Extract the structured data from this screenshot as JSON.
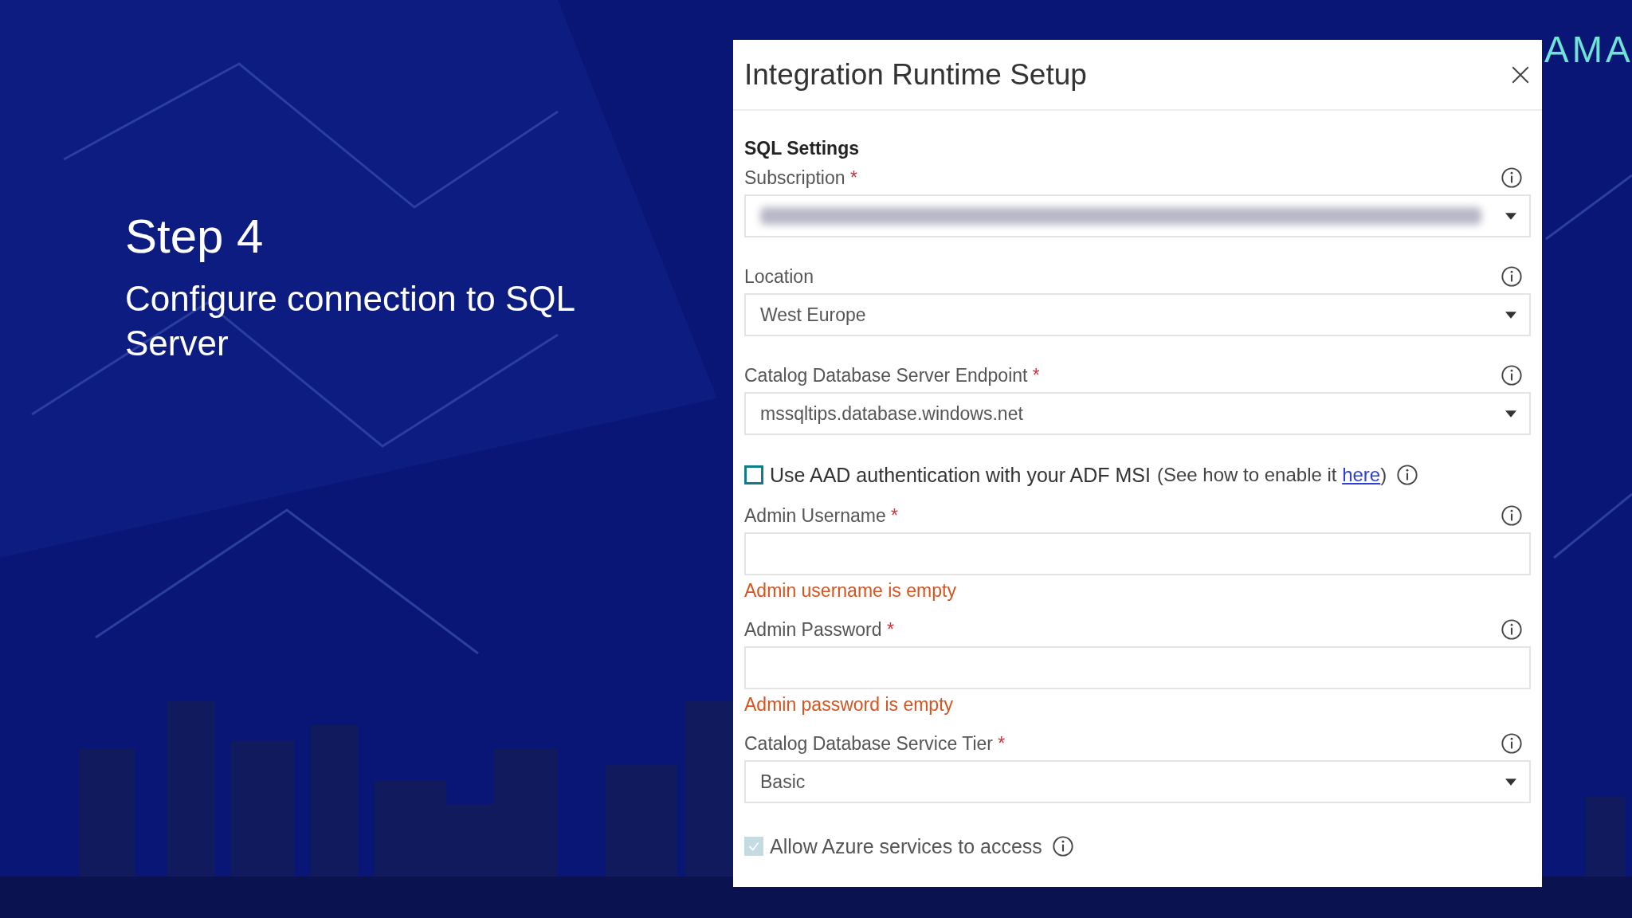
{
  "slide": {
    "heading": "Step 4",
    "subheading": "Configure connection to SQL Server",
    "logo": "AMA"
  },
  "dialog": {
    "title": "Integration Runtime Setup",
    "section": "SQL Settings",
    "items": [
      {
        "kind": "dropdown",
        "label": "Subscription",
        "required_mark": "*",
        "redacted": true
      },
      {
        "kind": "dropdown",
        "label": "Location",
        "value": "West Europe"
      },
      {
        "kind": "dropdown",
        "label": "Catalog Database Server Endpoint",
        "required_mark": "*",
        "value": "mssqltips.database.windows.net"
      },
      {
        "kind": "checkbox",
        "label": "Use AAD authentication with your ADF MSI",
        "note": "(See how to enable it",
        "link": "here",
        "note_end": ")",
        "checked": false,
        "disabled": false
      },
      {
        "kind": "text",
        "label": "Admin Username",
        "required_mark": "*",
        "error": "Admin username is empty"
      },
      {
        "kind": "text",
        "label": "Admin Password",
        "required_mark": "*",
        "error": "Admin password is empty"
      },
      {
        "kind": "dropdown",
        "label": "Catalog Database Service Tier",
        "required_mark": "*",
        "value": "Basic"
      },
      {
        "kind": "checkbox",
        "label": "Allow Azure services to access",
        "checked": true,
        "disabled": true
      }
    ]
  }
}
